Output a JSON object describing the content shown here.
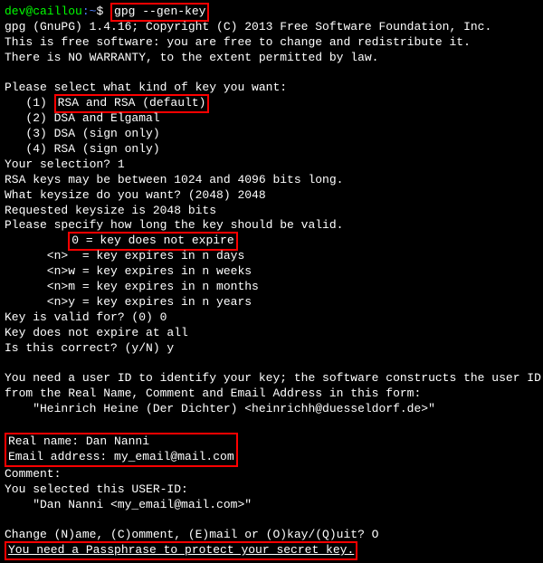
{
  "prompt": {
    "user": "dev@caillou",
    "path": ":~",
    "sym": "$ ",
    "command": "gpg --gen-key"
  },
  "header": {
    "l1": "gpg (GnuPG) 1.4.16; Copyright (C) 2013 Free Software Foundation, Inc.",
    "l2": "This is free software: you are free to change and redistribute it.",
    "l3": "There is NO WARRANTY, to the extent permitted by law."
  },
  "keytype": {
    "prompt": "Please select what kind of key you want:",
    "opt1_num": "   (1) ",
    "opt1_text": "RSA and RSA (default)",
    "opt2": "   (2) DSA and Elgamal",
    "opt3": "   (3) DSA (sign only)",
    "opt4": "   (4) RSA (sign only)",
    "selection": "Your selection? 1"
  },
  "keysize": {
    "range": "RSA keys may be between 1024 and 4096 bits long.",
    "prompt": "What keysize do you want? (2048) 2048",
    "result": "Requested keysize is 2048 bits"
  },
  "validity": {
    "prompt": "Please specify how long the key should be valid.",
    "opt0_pad": "         ",
    "opt0_text": "0 = key does not expire",
    "optn": "      <n>  = key expires in n days",
    "optnw": "      <n>w = key expires in n weeks",
    "optnm": "      <n>m = key expires in n months",
    "optny": "      <n>y = key expires in n years",
    "valid_for": "Key is valid for? (0) 0",
    "no_expire": "Key does not expire at all",
    "confirm": "Is this correct? (y/N) y"
  },
  "userid": {
    "intro1": "You need a user ID to identify your key; the software constructs the user ID",
    "intro2": "from the Real Name, Comment and Email Address in this form:",
    "example": "    \"Heinrich Heine (Der Dichter) <heinrichh@duesseldorf.de>\"",
    "realname": "Real name: Dan Nanni",
    "email": "Email address: my_email@mail.com",
    "comment": "Comment:",
    "selected": "You selected this USER-ID:",
    "selected_val": "    \"Dan Nanni <my_email@mail.com>\""
  },
  "change": {
    "prompt": "Change (N)ame, (C)omment, (E)mail or (O)kay/(Q)uit? O",
    "passphrase": "You need a Passphrase to protect your secret key."
  }
}
